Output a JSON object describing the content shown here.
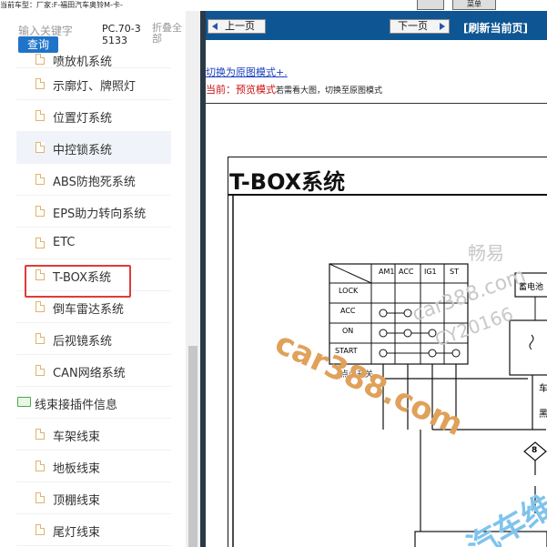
{
  "header": {
    "breadcrumb": "当前车型：厂家:F-福田汽车奥铃M-卡-",
    "top_button_label": "菜单"
  },
  "sidebar": {
    "search_placeholder": "输入关键字",
    "search_button": "查询",
    "model_code": "PC.70-35133",
    "collapse_all": "折叠全部",
    "items": [
      {
        "label": "喷放机系统",
        "type": "doc"
      },
      {
        "label": "示廓灯、牌照灯",
        "type": "doc"
      },
      {
        "label": "位置灯系统",
        "type": "doc"
      },
      {
        "label": "中控锁系统",
        "type": "doc"
      },
      {
        "label": "ABS防抱死系统",
        "type": "doc"
      },
      {
        "label": "EPS助力转向系统",
        "type": "doc"
      },
      {
        "label": "ETC",
        "type": "doc"
      },
      {
        "label": "T-BOX系统",
        "type": "doc"
      },
      {
        "label": "倒车雷达系统",
        "type": "doc"
      },
      {
        "label": "后视镜系统",
        "type": "doc"
      },
      {
        "label": "CAN网络系统",
        "type": "doc"
      },
      {
        "label": "线束接插件信息",
        "type": "folder"
      },
      {
        "label": "车架线束",
        "type": "doc"
      },
      {
        "label": "地板线束",
        "type": "doc"
      },
      {
        "label": "顶棚线束",
        "type": "doc"
      },
      {
        "label": "尾灯线束",
        "type": "doc"
      }
    ]
  },
  "content": {
    "prev_button": "上一页",
    "next_button": "下一页",
    "refresh_link": "[刷新当前页]",
    "mode_link": "切换为原图模式+.",
    "mode_prefix": "当前：",
    "mode_name": "预览模式",
    "mode_hint": "若需看大图，切换至原图模式",
    "diagram_title": "T-BOX系统"
  },
  "diagram": {
    "switch_columns": [
      "AM1",
      "ACC",
      "IG1",
      "ST"
    ],
    "switch_rows": [
      "LOCK",
      "ACC",
      "ON",
      "START"
    ],
    "switch_caption": "点火开关",
    "battery_label": "蓄电池",
    "connector_number": "8",
    "side_labels": [
      "车",
      "黑"
    ]
  },
  "watermarks": [
    "畅易",
    "car388.com",
    "CY20166",
    "car388.com",
    "汽车维"
  ]
}
